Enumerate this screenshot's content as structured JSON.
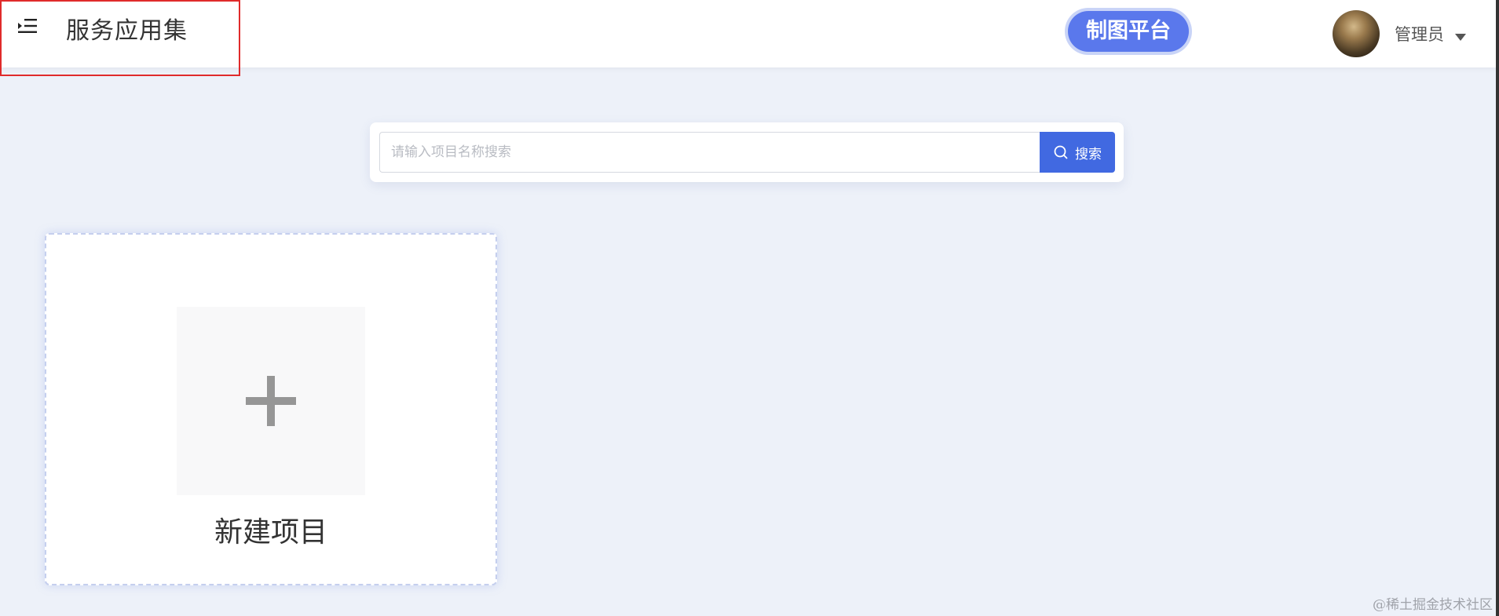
{
  "header": {
    "app_title": "服务应用集",
    "platform_badge": "制图平台",
    "user_name": "管理员",
    "menu_icon": "menu-indent-icon",
    "caret_icon": "caret-down-icon"
  },
  "search": {
    "placeholder": "请输入项目名称搜索",
    "value": "",
    "button_label": "搜索",
    "icon": "search-icon"
  },
  "new_project": {
    "label": "新建项目",
    "icon": "plus-icon"
  },
  "watermark": "@稀土掘金技术社区",
  "colors": {
    "accent": "#4169e1",
    "badge": "#5a78ec",
    "background": "#edf1f9",
    "highlight_border": "#e02b2b"
  }
}
